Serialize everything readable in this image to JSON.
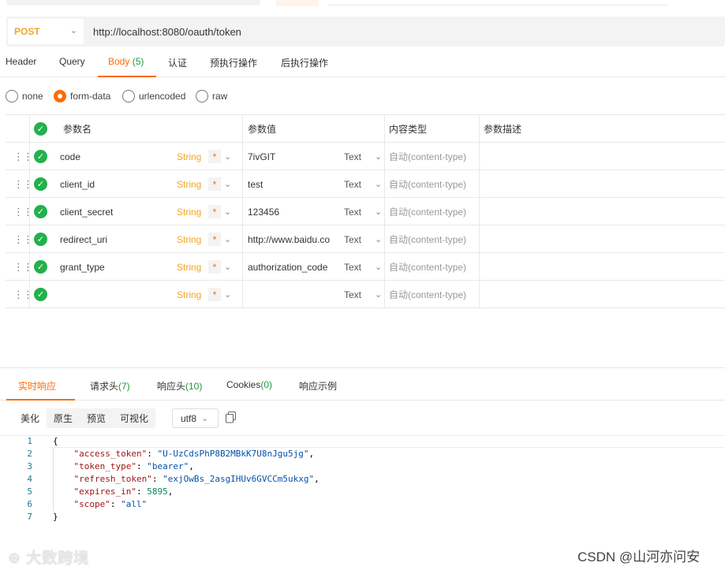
{
  "request": {
    "method": "POST",
    "url": "http://localhost:8080/oauth/token"
  },
  "tabs": [
    {
      "label": "Header",
      "count": ""
    },
    {
      "label": "Query",
      "count": ""
    },
    {
      "label": "Body",
      "count": "(5)"
    },
    {
      "label": "认证",
      "count": ""
    },
    {
      "label": "预执行操作",
      "count": ""
    },
    {
      "label": "后执行操作",
      "count": ""
    }
  ],
  "body_types": [
    "none",
    "form-data",
    "urlencoded",
    "raw"
  ],
  "body_type_selected": "form-data",
  "params": {
    "headers": [
      "参数名",
      "参数值",
      "内容类型",
      "参数描述"
    ],
    "rows": [
      {
        "name": "code",
        "type": "String",
        "required": "*",
        "value": "7ivGIT",
        "value_type": "Text",
        "content_type": "自动(content-type)"
      },
      {
        "name": "client_id",
        "type": "String",
        "required": "*",
        "value": "test",
        "value_type": "Text",
        "content_type": "自动(content-type)"
      },
      {
        "name": "client_secret",
        "type": "String",
        "required": "*",
        "value": "123456",
        "value_type": "Text",
        "content_type": "自动(content-type)"
      },
      {
        "name": "redirect_uri",
        "type": "String",
        "required": "*",
        "value": "http://www.baidu.co",
        "value_type": "Text",
        "content_type": "自动(content-type)"
      },
      {
        "name": "grant_type",
        "type": "String",
        "required": "*",
        "value": "authorization_code",
        "value_type": "Text",
        "content_type": "自动(content-type)"
      },
      {
        "name": "",
        "type": "String",
        "required": "*",
        "value": "",
        "value_type": "Text",
        "content_type": "自动(content-type)"
      }
    ]
  },
  "response_tabs": [
    {
      "label": "实时响应",
      "count": ""
    },
    {
      "label": "请求头",
      "count": "(7)"
    },
    {
      "label": "响应头",
      "count": "(10)"
    },
    {
      "label": "Cookies",
      "count": "(0)"
    },
    {
      "label": "响应示例",
      "count": ""
    }
  ],
  "view_modes": [
    "美化",
    "原生",
    "预览",
    "可视化"
  ],
  "encoding": "utf8",
  "response_json": {
    "lines": [
      {
        "num": "1",
        "key": "",
        "value": "",
        "text": "{"
      },
      {
        "num": "2",
        "key": "\"access_token\"",
        "value": "\"U-UzCdsPhP8B2MBkK7U8nJgu5jg\"",
        "kind": "s",
        "comma": ","
      },
      {
        "num": "3",
        "key": "\"token_type\"",
        "value": "\"bearer\"",
        "kind": "s",
        "comma": ","
      },
      {
        "num": "4",
        "key": "\"refresh_token\"",
        "value": "\"exjOwBs_2asgIHUv6GVCCm5ukxg\"",
        "kind": "s",
        "comma": ","
      },
      {
        "num": "5",
        "key": "\"expires_in\"",
        "value": "5895",
        "kind": "n",
        "comma": ","
      },
      {
        "num": "6",
        "key": "\"scope\"",
        "value": "\"all\"",
        "kind": "s",
        "comma": ""
      },
      {
        "num": "7",
        "key": "",
        "value": "",
        "text": "}"
      }
    ]
  },
  "watermarks": {
    "left": "大数跨境",
    "right": "CSDN @山河亦问安"
  },
  "colors": {
    "accent": "#ff6a00",
    "method": "#f5a623",
    "count": "#1a9c3e",
    "check": "#22b14c"
  }
}
